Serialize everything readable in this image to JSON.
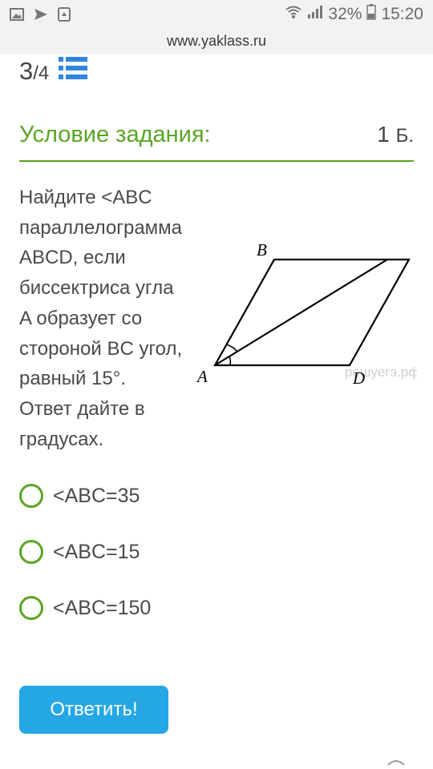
{
  "status_bar": {
    "battery_percent": "32%",
    "time": "15:20",
    "left_icons": [
      "image-icon",
      "send-icon",
      "recycle-icon"
    ],
    "right_icons": [
      "wifi-icon",
      "signal-icon",
      "battery-icon"
    ]
  },
  "browser": {
    "url": "www.yaklass.ru"
  },
  "progress": {
    "current": "3",
    "total": "/4",
    "list_icon": "list-icon"
  },
  "task": {
    "heading": "Условие задания:",
    "points_value": "1",
    "points_unit": "Б.",
    "question_lines": [
      "Найдите <ABC",
      "параллелограмма",
      "ABCD, если",
      "биссектриса угла",
      "A образует со",
      "стороной BC угол,",
      "равный 15°.",
      "Ответ дайте в",
      "градусах."
    ],
    "figure": {
      "label_b": "B",
      "label_a": "A",
      "label_d": "D",
      "watermark": "решуегэ.рф"
    }
  },
  "answers": [
    {
      "label": "<ABC=35"
    },
    {
      "label": "<ABC=15"
    },
    {
      "label": "<ABC=150"
    }
  ],
  "submit": {
    "label": "Ответить!"
  },
  "colors": {
    "accent_green": "#5aa524",
    "button_blue": "#25a7e6"
  }
}
